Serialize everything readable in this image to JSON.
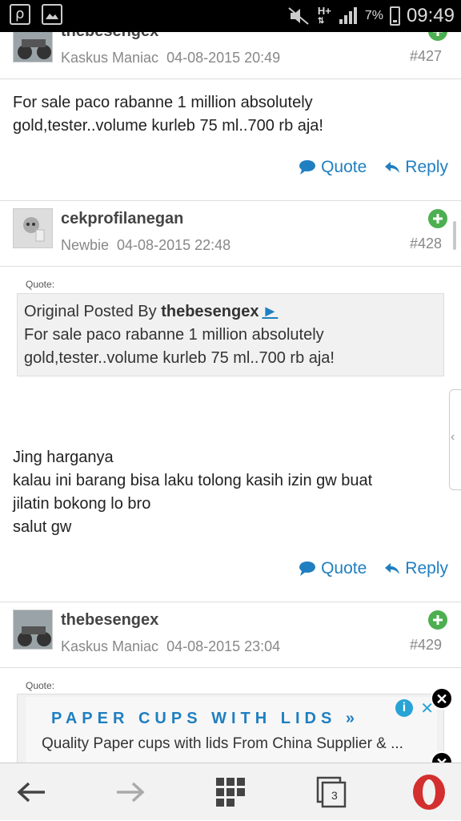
{
  "status_bar": {
    "network": "H+",
    "battery": "7%",
    "time": "09:49"
  },
  "posts": [
    {
      "username": "thebesengex",
      "rank": "Kaskus Maniac",
      "date": "04-08-2015 20:49",
      "number": "#427",
      "body": [
        "For sale paco rabanne 1 million absolutely",
        "gold,tester..volume kurleb 75 ml..700 rb aja!"
      ],
      "quote_label": "Quote",
      "reply_label": "Reply"
    },
    {
      "username": "cekprofilanegan",
      "rank": "Newbie",
      "date": "04-08-2015 22:48",
      "number": "#428",
      "quote_heading": "Quote:",
      "quoted_prefix": "Original Posted By",
      "quoted_author": "thebesengex",
      "quoted_arrow": "►",
      "quoted_text": [
        "For sale paco rabanne 1 million absolutely",
        "gold,tester..volume kurleb 75 ml..700 rb aja!"
      ],
      "body": [
        "Jing harganya",
        "kalau ini barang bisa laku tolong kasih izin gw buat",
        "jilatin bokong lo bro",
        "salut gw"
      ],
      "quote_label": "Quote",
      "reply_label": "Reply"
    },
    {
      "username": "thebesengex",
      "rank": "Kaskus Maniac",
      "date": "04-08-2015 23:04",
      "number": "#429",
      "quote_heading": "Quote:"
    }
  ],
  "ad": {
    "title": "PAPER CUPS WITH LIDS",
    "arrow": "»",
    "subtitle": "Quality Paper cups with lids From China Supplier & ..."
  },
  "navbar": {
    "tabs_count": "3"
  },
  "colors": {
    "link_blue": "#1f7fc0",
    "add_green": "#4caf50",
    "opera_red": "#d32f2f"
  }
}
